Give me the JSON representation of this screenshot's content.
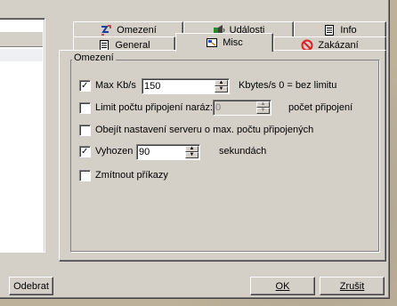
{
  "tabs_row1": [
    {
      "label": "Omezení",
      "icon": "speed-limit-icon"
    },
    {
      "label": "Události",
      "icon": "events-icon"
    },
    {
      "label": "Info",
      "icon": "info-document-icon"
    }
  ],
  "tabs_row2": [
    {
      "label": "General",
      "icon": "general-document-icon"
    },
    {
      "label": "Misc",
      "icon": "misc-icon",
      "active": true
    },
    {
      "label": "Zakázaní",
      "icon": "forbidden-icon"
    }
  ],
  "group": {
    "legend": "Omezení"
  },
  "options": {
    "max_kbs": {
      "label": "Max Kb/s",
      "checked": true,
      "value": "150",
      "suffix": "Kbytes/s 0 = bez limitu"
    },
    "limit_connections": {
      "label": "Limit počtu připojení naráz:",
      "checked": false,
      "value": "0",
      "suffix": "počet připojení"
    },
    "bypass_server": {
      "label": "Obejít nastavení serveru o max. počtu připojených",
      "checked": false
    },
    "kick": {
      "label": "Vyhozen",
      "checked": true,
      "value": "90",
      "suffix": "sekundách"
    },
    "ignore_commands": {
      "label": "Zmítnout příkazy",
      "checked": false
    }
  },
  "buttons": {
    "remove": "Odebrat",
    "ok": "OK",
    "cancel": "Zrušit"
  },
  "colors": {
    "dialog_bg": "#d4d0c8",
    "desktop_bg": "#bdb19a",
    "forbidden_red": "#e02020"
  }
}
